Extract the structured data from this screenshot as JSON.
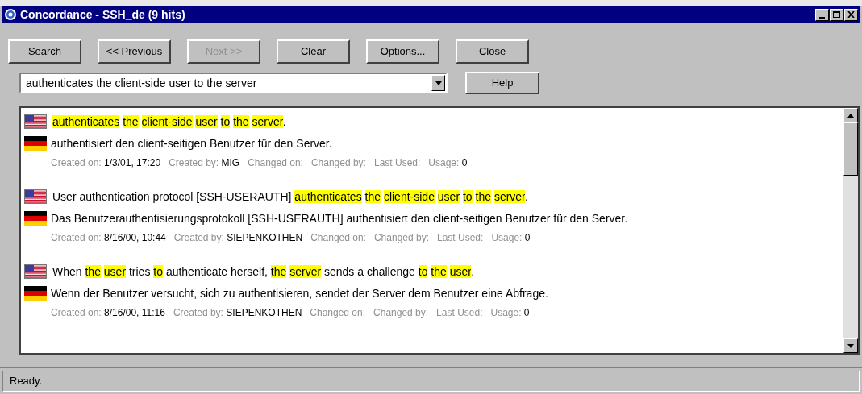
{
  "window": {
    "title": "Concordance - SSH_de (9 hits)"
  },
  "buttons": [
    {
      "label": "Search",
      "disabled": false
    },
    {
      "label": "<< Previous",
      "disabled": false
    },
    {
      "label": "Next >>",
      "disabled": true
    },
    {
      "label": "Clear",
      "disabled": false
    },
    {
      "label": "Options...",
      "disabled": false
    },
    {
      "label": "Close",
      "disabled": false
    }
  ],
  "search": {
    "value": "authenticates the client-side user to the server"
  },
  "help_button": {
    "label": "Help"
  },
  "results": [
    {
      "source": [
        {
          "text": "authenticates",
          "highlighted": true,
          "attached": false
        },
        {
          "text": "the",
          "highlighted": true,
          "attached": false
        },
        {
          "text": "client-side",
          "highlighted": true,
          "attached": false
        },
        {
          "text": "user",
          "highlighted": true,
          "attached": false
        },
        {
          "text": "to",
          "highlighted": true,
          "attached": false
        },
        {
          "text": "the",
          "highlighted": true,
          "attached": false
        },
        {
          "text": "server",
          "highlighted": true,
          "attached": false
        },
        {
          "text": ".",
          "highlighted": false,
          "attached": true
        }
      ],
      "target": "authentisiert den client-seitigen Benutzer für den Server.",
      "meta": [
        {
          "label": "Created on:",
          "value": "1/3/01, 17:20"
        },
        {
          "label": "Created by:",
          "value": "MIG"
        },
        {
          "label": "Changed on:"
        },
        {
          "label": "Changed by:"
        },
        {
          "label": "Last Used:"
        },
        {
          "label": "Usage:",
          "value": "0"
        }
      ]
    },
    {
      "source": [
        {
          "text": "User authentication protocol [SSH-USERAUTH]",
          "highlighted": false,
          "attached": false
        },
        {
          "text": "authenticates",
          "highlighted": true,
          "attached": false
        },
        {
          "text": "the",
          "highlighted": true,
          "attached": false
        },
        {
          "text": "client-side",
          "highlighted": true,
          "attached": false
        },
        {
          "text": "user",
          "highlighted": true,
          "attached": false
        },
        {
          "text": "to",
          "highlighted": true,
          "attached": false
        },
        {
          "text": "the",
          "highlighted": true,
          "attached": false
        },
        {
          "text": "server",
          "highlighted": true,
          "attached": false
        },
        {
          "text": ".",
          "highlighted": false,
          "attached": true
        }
      ],
      "target": "Das Benutzerauthentisierungsprotokoll [SSH-USERAUTH] authentisiert den client-seitigen Benutzer für den Server.",
      "meta": [
        {
          "label": "Created on:",
          "value": "8/16/00, 10:44"
        },
        {
          "label": "Created by:",
          "value": "SIEPENKOTHEN"
        },
        {
          "label": "Changed on:"
        },
        {
          "label": "Changed by:"
        },
        {
          "label": "Last Used:"
        },
        {
          "label": "Usage:",
          "value": "0"
        }
      ]
    },
    {
      "source": [
        {
          "text": "When",
          "highlighted": false,
          "attached": false
        },
        {
          "text": "the",
          "highlighted": true,
          "attached": false
        },
        {
          "text": "user",
          "highlighted": true,
          "attached": false
        },
        {
          "text": "tries",
          "highlighted": false,
          "attached": false
        },
        {
          "text": "to",
          "highlighted": true,
          "attached": false
        },
        {
          "text": "authenticate herself,",
          "highlighted": false,
          "attached": false
        },
        {
          "text": "the",
          "highlighted": true,
          "attached": false
        },
        {
          "text": "server",
          "highlighted": true,
          "attached": false
        },
        {
          "text": "sends a challenge",
          "highlighted": false,
          "attached": false
        },
        {
          "text": "to",
          "highlighted": true,
          "attached": false
        },
        {
          "text": "the",
          "highlighted": true,
          "attached": false
        },
        {
          "text": "user",
          "highlighted": true,
          "attached": false
        },
        {
          "text": ".",
          "highlighted": false,
          "attached": true
        }
      ],
      "target": "Wenn der Benutzer versucht, sich zu authentisieren, sendet der Server dem Benutzer eine Abfrage.",
      "meta": [
        {
          "label": "Created on:",
          "value": "8/16/00, 11:16"
        },
        {
          "label": "Created by:",
          "value": "SIEPENKOTHEN"
        },
        {
          "label": "Changed on:"
        },
        {
          "label": "Changed by:"
        },
        {
          "label": "Last Used:"
        },
        {
          "label": "Usage:",
          "value": "0"
        }
      ]
    }
  ],
  "status_bar": "Ready."
}
